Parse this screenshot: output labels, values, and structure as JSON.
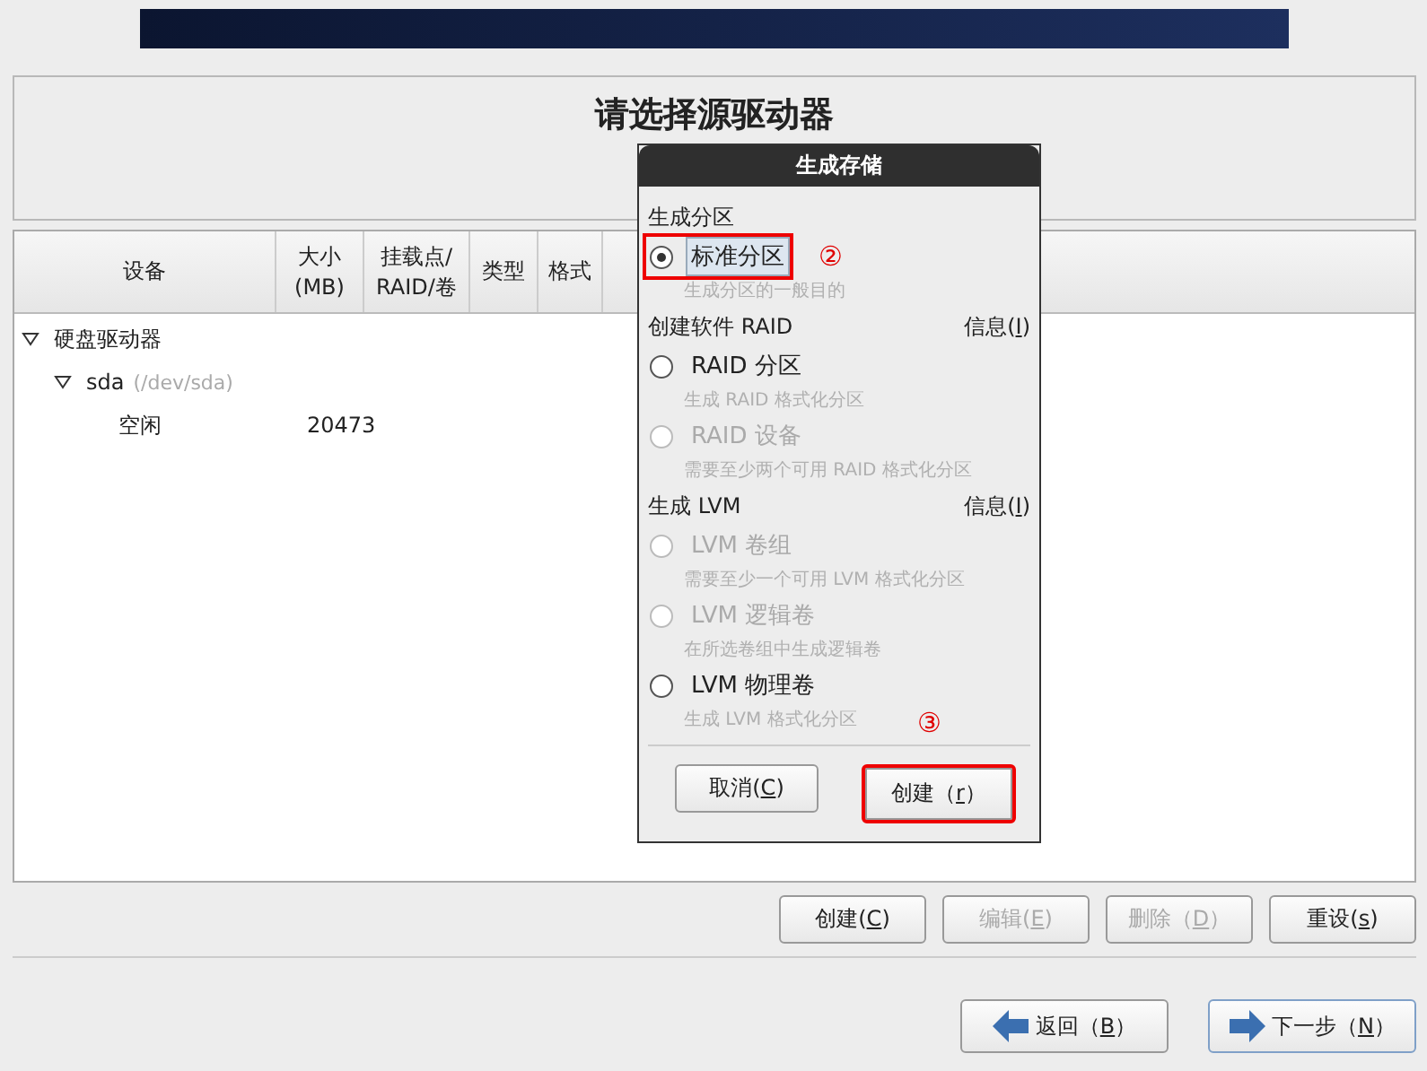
{
  "header": {
    "title": "请选择源驱动器"
  },
  "table": {
    "columns": [
      {
        "lines": [
          "设备"
        ]
      },
      {
        "lines": [
          "大小",
          "(MB)"
        ]
      },
      {
        "lines": [
          "挂载点/",
          "RAID/卷"
        ]
      },
      {
        "lines": [
          "类型"
        ]
      },
      {
        "lines": [
          "格式"
        ]
      }
    ],
    "tree": [
      {
        "name": "硬盘驱动器",
        "expanded": true,
        "children": [
          {
            "name": "sda",
            "path": "(/dev/sda)",
            "expanded": true,
            "children": [
              {
                "name": "空闲",
                "size": "20473"
              }
            ]
          }
        ]
      }
    ]
  },
  "actions": [
    {
      "before": "创建(",
      "key": "C",
      "after": ")",
      "disabled": false
    },
    {
      "before": "编辑(",
      "key": "E",
      "after": ")",
      "disabled": true
    },
    {
      "before": "删除（",
      "key": "D",
      "after": "）",
      "disabled": true
    },
    {
      "before": "重设(",
      "key": "s",
      "after": ")",
      "disabled": false
    }
  ],
  "nav": [
    {
      "kind": "back",
      "before": "返回（",
      "key": "B",
      "after": "）",
      "focused": false
    },
    {
      "kind": "next",
      "before": "下一步（",
      "key": "N",
      "after": "）",
      "focused": true
    }
  ],
  "dialog": {
    "title": "生成存储",
    "sections": [
      {
        "heading": "生成分区",
        "options": [
          {
            "label": "标准分区",
            "hint": "生成分区的一般目的",
            "selected": true,
            "disabled": false,
            "annotation": "②"
          }
        ]
      },
      {
        "heading": "创建软件 RAID",
        "info": {
          "before": "信息(",
          "key": "I",
          "after": ")"
        },
        "options": [
          {
            "label": "RAID 分区",
            "hint": "生成 RAID 格式化分区",
            "selected": false,
            "disabled": false
          },
          {
            "label": "RAID 设备",
            "hint": "需要至少两个可用 RAID 格式化分区",
            "selected": false,
            "disabled": true
          }
        ]
      },
      {
        "heading": "生成 LVM",
        "info": {
          "before": "信息(",
          "key": "I",
          "after": ")"
        },
        "options": [
          {
            "label": "LVM 卷组",
            "hint": "需要至少一个可用 LVM 格式化分区",
            "selected": false,
            "disabled": true
          },
          {
            "label": "LVM 逻辑卷",
            "hint": "在所选卷组中生成逻辑卷",
            "selected": false,
            "disabled": true
          },
          {
            "label": "LVM 物理卷",
            "hint": "生成 LVM 格式化分区",
            "selected": false,
            "disabled": false
          }
        ]
      }
    ],
    "buttons": [
      {
        "before": "取消(",
        "key": "C",
        "after": ")",
        "highlighted": false
      },
      {
        "before": "创建（",
        "key": "r",
        "after": "）",
        "highlighted": true
      }
    ],
    "annotation": "③"
  }
}
